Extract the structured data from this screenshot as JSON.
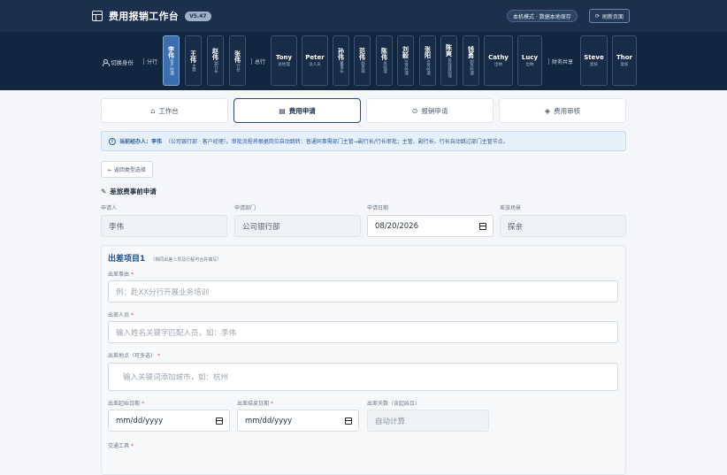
{
  "header": {
    "title": "费用报销工作台",
    "version": "V5.47",
    "mode_badge": "本机模式 · 数据本地保存",
    "refresh_label": "刷新页面"
  },
  "identity": {
    "switch_label": "切换身份",
    "groups": {
      "branch": "分行",
      "head_office": "总行",
      "shared": "财务共享"
    },
    "branch_people": [
      {
        "name": "李伟",
        "role": "客户经理",
        "active": true
      },
      {
        "name": "王伟",
        "role": "主管"
      },
      {
        "name": "赵伟",
        "role": "副行长"
      },
      {
        "name": "张伟",
        "role": "行长"
      }
    ],
    "head_people": [
      {
        "name": "Tony",
        "role": "总经理"
      },
      {
        "name": "Peter",
        "role": "派人员"
      },
      {
        "name": "孙伟",
        "role": "董事长"
      },
      {
        "name": "范伟",
        "role": "副总裁"
      },
      {
        "name": "陈伟",
        "role": "总经理"
      },
      {
        "name": "刘毅",
        "role": "业务经理"
      },
      {
        "name": "张阳",
        "role": "业务经理"
      },
      {
        "name": "陈爽",
        "role": "总经理助理"
      },
      {
        "name": "钱勇",
        "role": "副总经理"
      },
      {
        "name": "Cathy",
        "role": "出纳"
      },
      {
        "name": "Lucy",
        "role": "出纳"
      }
    ],
    "shared_people": [
      {
        "name": "Steve",
        "role": "复核"
      },
      {
        "name": "Thor",
        "role": "复核"
      }
    ]
  },
  "tabs": [
    {
      "label": "工作台",
      "icon": "home-icon"
    },
    {
      "label": "费用申请",
      "icon": "document-icon",
      "active": true
    },
    {
      "label": "报销申请",
      "icon": "check-circle-icon"
    },
    {
      "label": "费用审核",
      "icon": "layers-icon"
    }
  ],
  "notice": {
    "prefix": "当前经办人：李伟",
    "detail": "（公司银行部 · 客户经理）。审批流程将根据岗位自动跳转：普通同事需部门主管→副行长/行长审批；主管、副行长、行长自动跳过部门主管节点。"
  },
  "back_button": "← 返回类型选择",
  "form": {
    "title": "差旅费事前申请",
    "applicant_label": "申请人",
    "applicant_value": "李伟",
    "dept_label": "申请部门",
    "dept_value": "公司银行部",
    "date_label": "申请日期",
    "date_value": "08/20/2026",
    "scene_label": "差旅场景",
    "scene_value": "探亲"
  },
  "trip": {
    "title": "出差项目1",
    "note": "（相同出差人员及行程可合并填写）",
    "reason_label": "出差事由",
    "reason_placeholder": "例：赴XX分行开展业务培训",
    "people_label": "出差人员",
    "people_placeholder": "输入姓名关键字匹配人员，如：李伟",
    "place_label": "出差地点（可多选）",
    "place_placeholder": "输入关键词添加城市，如：杭州",
    "start_label": "出差起始日期",
    "start_placeholder": "mm/dd/yyyy",
    "end_label": "出差结束日期",
    "end_placeholder": "mm/dd/yyyy",
    "days_label": "出差天数（含起始日）",
    "days_placeholder": "自动计算",
    "transport_label": "交通工具"
  }
}
